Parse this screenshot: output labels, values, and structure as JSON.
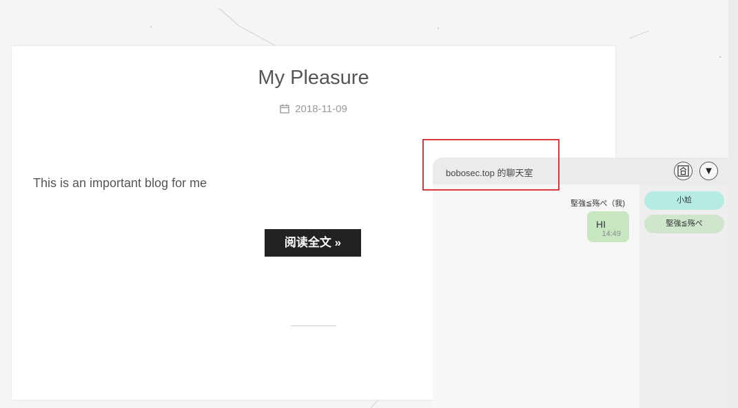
{
  "post": {
    "title": "My Pleasure",
    "date": "2018-11-09",
    "body": "This is an important blog for me",
    "read_more_label": "阅读全文 »"
  },
  "chat": {
    "title": "bobosec.top 的聊天室",
    "home_icon": "room-icon",
    "collapse_icon": "collapse-down-icon",
    "collapse_glyph": "▼",
    "messages": [
      {
        "sender": "堅強≦殇ぺ（我)",
        "text": "HI",
        "time": "14:49"
      }
    ],
    "users": [
      {
        "name": "小尬",
        "color": "#b4ebe2"
      },
      {
        "name": "堅強≦殇ぺ",
        "color": "#cfe5cc"
      }
    ]
  },
  "colors": {
    "highlight": "#d9373b",
    "button_bg": "#222222",
    "bubble_bg": "#c8e6c0"
  }
}
